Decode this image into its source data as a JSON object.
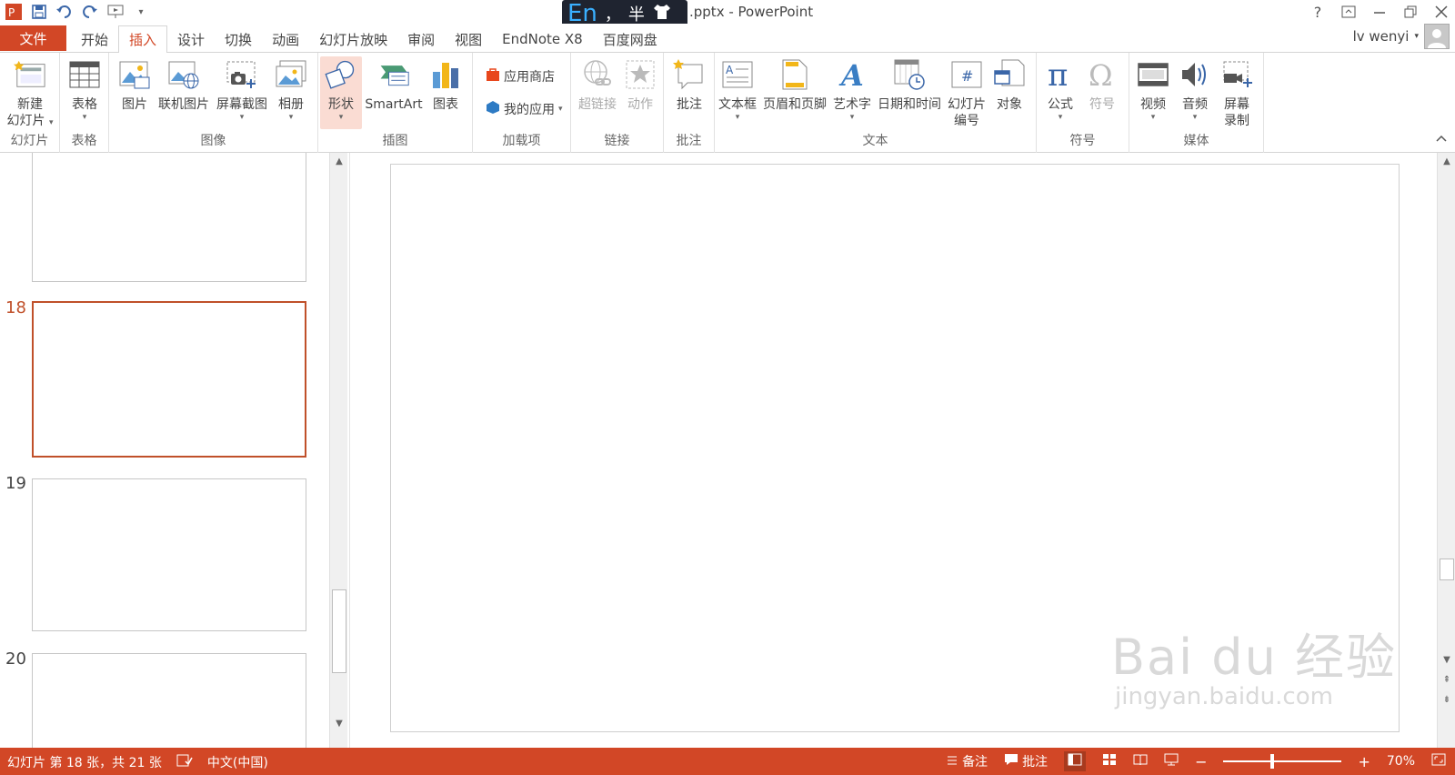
{
  "window": {
    "title": ".pptx - PowerPoint",
    "ime": {
      "mode": "En",
      "punct": "，",
      "width": "半"
    }
  },
  "tabs": {
    "file": "文件",
    "items": [
      "开始",
      "插入",
      "设计",
      "切换",
      "动画",
      "幻灯片放映",
      "审阅",
      "视图",
      "EndNote X8",
      "百度网盘"
    ],
    "active": "插入"
  },
  "user": {
    "name": "lv wenyi"
  },
  "ribbon": {
    "groups": {
      "slides": "幻灯片",
      "tables": "表格",
      "images": "图像",
      "illustrations": "插图",
      "addins": "加载项",
      "links": "链接",
      "comments": "批注",
      "text": "文本",
      "symbols": "符号",
      "media": "媒体"
    },
    "buttons": {
      "new_slide_1": "新建",
      "new_slide_2": "幻灯片",
      "table": "表格",
      "picture": "图片",
      "online_picture": "联机图片",
      "screenshot": "屏幕截图",
      "album": "相册",
      "shapes": "形状",
      "smartart": "SmartArt",
      "chart": "图表",
      "store": "应用商店",
      "my_apps": "我的应用",
      "hyperlink": "超链接",
      "action": "动作",
      "comment": "批注",
      "textbox": "文本框",
      "header_footer": "页眉和页脚",
      "wordart": "艺术字",
      "datetime": "日期和时间",
      "slide_number_1": "幻灯片",
      "slide_number_2": "编号",
      "object": "对象",
      "equation": "公式",
      "symbol": "符号",
      "video": "视频",
      "audio": "音频",
      "screen_record_1": "屏幕",
      "screen_record_2": "录制"
    }
  },
  "thumbnails": {
    "selected": "18",
    "numbers": [
      "18",
      "19",
      "20"
    ]
  },
  "watermark": {
    "brand": "Bai du 经验",
    "url": "jingyan.baidu.com"
  },
  "status": {
    "slide_info": "幻灯片 第 18 张，共 21 张",
    "language": "中文(中国)",
    "notes": "备注",
    "comments": "批注",
    "zoom": "70%",
    "zoom_minus": "−",
    "zoom_plus": "+"
  },
  "colors": {
    "accent": "#d24726",
    "selected_thumb": "#c0502a"
  }
}
